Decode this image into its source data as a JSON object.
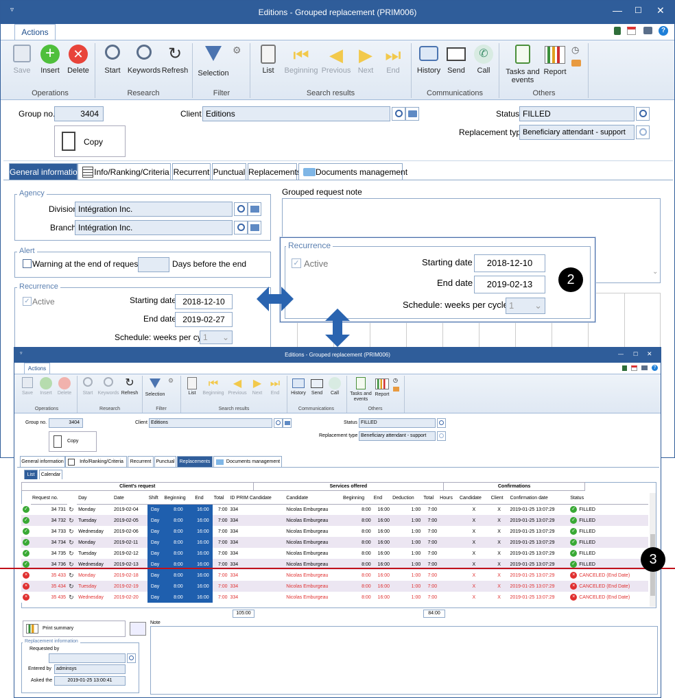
{
  "main": {
    "title": "Editions - Grouped replacement (PRIM006)",
    "tab_actions": "Actions",
    "ribbon": {
      "save": "Save",
      "insert": "Insert",
      "delete": "Delete",
      "start": "Start",
      "keywords": "Keywords",
      "refresh": "Refresh",
      "selection": "Selection",
      "list": "List",
      "beginning": "Beginning",
      "previous": "Previous",
      "next": "Next",
      "end": "End",
      "history": "History",
      "send": "Send",
      "call": "Call",
      "tasks_line1": "Tasks and",
      "tasks_line2": "events",
      "report": "Report",
      "groups": {
        "operations": "Operations",
        "research": "Research",
        "filter": "Filter",
        "search_results": "Search results",
        "communications": "Communications",
        "others": "Others"
      }
    },
    "group_no_label": "Group no.",
    "group_no": "3404",
    "client_label": "Client",
    "client": "Editions",
    "status_label": "Status",
    "status": "FILLED",
    "replacement_type_label": "Replacement type",
    "replacement_type": "Beneficiary attendant - support",
    "copy": "Copy",
    "tabs": [
      "General information",
      "Info/Ranking/Criteria",
      "Recurrent",
      "Punctual",
      "Replacements",
      "Documents management"
    ],
    "agency": {
      "legend": "Agency",
      "division_label": "Division",
      "division": "Intégration Inc.",
      "branch_label": "Branch",
      "branch": "Intégration Inc."
    },
    "alert": {
      "legend": "Alert",
      "warning": "Warning at the end of request",
      "days": "Days before the end"
    },
    "recurrence": {
      "legend": "Recurrence",
      "active": "Active",
      "start_label": "Starting date",
      "start": "2018-12-10",
      "end_label": "End date",
      "end": "2019-02-27",
      "schedule_label": "Schedule: weeks per cycle",
      "schedule": "1"
    },
    "note_label": "Grouped request note"
  },
  "zoom": {
    "legend": "Recurrence",
    "active": "Active",
    "start_label": "Starting date",
    "start": "2018-12-10",
    "end_label": "End date",
    "end": "2019-02-13",
    "schedule_label": "Schedule: weeks per cycle",
    "schedule": "1"
  },
  "callouts": {
    "two": "2",
    "three": "3"
  },
  "second": {
    "title": "Editions - Grouped replacement (PRIM006)",
    "tab_actions": "Actions",
    "group_no_label": "Group no.",
    "group_no": "3404",
    "client_label": "Client",
    "client": "Editions",
    "status_label": "Status",
    "status": "FILLED",
    "replacement_type_label": "Replacement type",
    "replacement_type": "Beneficiary attendant - support",
    "copy": "Copy",
    "tabs": [
      "General information",
      "Info/Ranking/Criteria",
      "Recurrent",
      "Punctual",
      "Replacements",
      "Documents management"
    ],
    "subtabs": [
      "List",
      "Calendar"
    ],
    "grid": {
      "group_headers": [
        "Client's request",
        "Services offered",
        "Confirmations"
      ],
      "columns": [
        "Request no.",
        "Day",
        "Date",
        "Shift",
        "Beginning",
        "End",
        "Total",
        "ID PRIM Candidate",
        "Candidate",
        "Beginning",
        "End",
        "Deduction",
        "Total",
        "Hours",
        "Candidate",
        "Client",
        "Confirmation date",
        "Status"
      ],
      "rows": [
        {
          "no": "34 731",
          "day": "Monday",
          "date": "2019-02-04",
          "shift": "Day",
          "beg": "8:00",
          "end": "16:00",
          "total": "7:00",
          "id": "334",
          "cand": "Nicolas Emburgeau",
          "sbeg": "8:00",
          "send": "16:00",
          "ded": "1:00",
          "stot": "7:00",
          "hours": "",
          "c": "X",
          "cl": "X",
          "conf": "2019-01-25 13:07:29",
          "status": "FILLED",
          "canceled": false
        },
        {
          "no": "34 732",
          "day": "Tuesday",
          "date": "2019-02-05",
          "shift": "Day",
          "beg": "8:00",
          "end": "16:00",
          "total": "7:00",
          "id": "334",
          "cand": "Nicolas Emburgeau",
          "sbeg": "8:00",
          "send": "16:00",
          "ded": "1:00",
          "stot": "7:00",
          "hours": "",
          "c": "X",
          "cl": "X",
          "conf": "2019-01-25 13:07:29",
          "status": "FILLED",
          "canceled": false
        },
        {
          "no": "34 733",
          "day": "Wednesday",
          "date": "2019-02-06",
          "shift": "Day",
          "beg": "8:00",
          "end": "16:00",
          "total": "7:00",
          "id": "334",
          "cand": "Nicolas Emburgeau",
          "sbeg": "8:00",
          "send": "16:00",
          "ded": "1:00",
          "stot": "7:00",
          "hours": "",
          "c": "X",
          "cl": "X",
          "conf": "2019-01-25 13:07:29",
          "status": "FILLED",
          "canceled": false
        },
        {
          "no": "34 734",
          "day": "Monday",
          "date": "2019-02-11",
          "shift": "Day",
          "beg": "8:00",
          "end": "16:00",
          "total": "7:00",
          "id": "334",
          "cand": "Nicolas Emburgeau",
          "sbeg": "8:00",
          "send": "16:00",
          "ded": "1:00",
          "stot": "7:00",
          "hours": "",
          "c": "X",
          "cl": "X",
          "conf": "2019-01-25 13:07:29",
          "status": "FILLED",
          "canceled": false
        },
        {
          "no": "34 735",
          "day": "Tuesday",
          "date": "2019-02-12",
          "shift": "Day",
          "beg": "8:00",
          "end": "16:00",
          "total": "7:00",
          "id": "334",
          "cand": "Nicolas Emburgeau",
          "sbeg": "8:00",
          "send": "16:00",
          "ded": "1:00",
          "stot": "7:00",
          "hours": "",
          "c": "X",
          "cl": "X",
          "conf": "2019-01-25 13:07:29",
          "status": "FILLED",
          "canceled": false
        },
        {
          "no": "34 736",
          "day": "Wednesday",
          "date": "2019-02-13",
          "shift": "Day",
          "beg": "8:00",
          "end": "16:00",
          "total": "7:00",
          "id": "334",
          "cand": "Nicolas Emburgeau",
          "sbeg": "8:00",
          "send": "16:00",
          "ded": "1:00",
          "stot": "7:00",
          "hours": "",
          "c": "X",
          "cl": "X",
          "conf": "2019-01-25 13:07:29",
          "status": "FILLED",
          "canceled": false
        },
        {
          "no": "35 433",
          "day": "Monday",
          "date": "2019-02-18",
          "shift": "Day",
          "beg": "8:00",
          "end": "16:00",
          "total": "7:00",
          "id": "334",
          "cand": "Nicolas Emburgeau",
          "sbeg": "8:00",
          "send": "16:00",
          "ded": "1:00",
          "stot": "7:00",
          "hours": "",
          "c": "X",
          "cl": "X",
          "conf": "2019-01-25 13:07:29",
          "status": "CANCELED (End Date)",
          "canceled": true
        },
        {
          "no": "35 434",
          "day": "Tuesday",
          "date": "2019-02-19",
          "shift": "Day",
          "beg": "8:00",
          "end": "16:00",
          "total": "7:00",
          "id": "334",
          "cand": "Nicolas Emburgeau",
          "sbeg": "8:00",
          "send": "16:00",
          "ded": "1:00",
          "stot": "7:00",
          "hours": "",
          "c": "X",
          "cl": "X",
          "conf": "2019-01-25 13:07:29",
          "status": "CANCELED (End Date)",
          "canceled": true
        },
        {
          "no": "35 435",
          "day": "Wednesday",
          "date": "2019-02-20",
          "shift": "Day",
          "beg": "8:00",
          "end": "16:00",
          "total": "7:00",
          "id": "334",
          "cand": "Nicolas Emburgeau",
          "sbeg": "8:00",
          "send": "16:00",
          "ded": "1:00",
          "stot": "7:00",
          "hours": "",
          "c": "X",
          "cl": "X",
          "conf": "2019-01-25 13:07:29",
          "status": "CANCELED (End Date)",
          "canceled": true
        }
      ],
      "total_request": "105:00",
      "total_offered": "84:00"
    },
    "print_summary": "Print summary",
    "note_label": "Note",
    "repl_info": {
      "legend": "Replacement information",
      "requested_by_label": "Requested by",
      "requested_by": "",
      "entered_by_label": "Entered by",
      "entered_by": "adminsys",
      "asked_label": "Asked the",
      "asked": "2019-01-25 13:00:41"
    }
  },
  "colors": {
    "title": "#2f5d9a",
    "tab_active": "#2f5d9a",
    "cell_blue": "#1f5fae",
    "cancel": "#e03030",
    "ok": "#39a935",
    "callout_line": "#c0101a"
  }
}
